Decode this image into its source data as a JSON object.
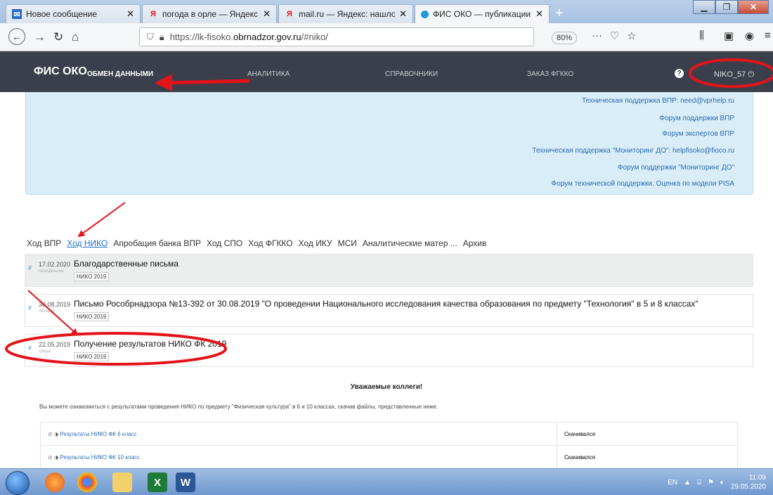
{
  "browser": {
    "tabs": [
      {
        "title": "Новое сообщение",
        "close": "✕"
      },
      {
        "title": "погода в орле — Яндекс: наш",
        "close": "✕"
      },
      {
        "title": "mail.ru — Яндекс: нашлось 12",
        "close": "✕"
      },
      {
        "title": "ФИС ОКО — публикации",
        "close": "✕"
      }
    ],
    "new_tab": "+",
    "url_prefix": "https://lk-fisoko.",
    "url_domain": "obrnadzor.gov.ru",
    "url_suffix": "/#niko/",
    "zoom": "80%",
    "more": "···"
  },
  "site": {
    "logo": "ФИС ОКО",
    "nav": [
      "ОБМЕН ДАННЫМИ",
      "АНАЛИТИКА",
      "СПРАВОЧНИКИ",
      "ЗАКАЗ ФГККО"
    ],
    "help": "?",
    "user": "NIKO_57"
  },
  "info_links": [
    "Техническая поддержка ВПР: need@vprhelp.ru",
    "Форум поддержки ВПР",
    "Форум экспертов ВПР",
    "Техническая поддержка \"Мониторинг ДО\": helpfisoko@fioco.ru",
    "Форум поддержки \"Мониторинг ДО\"",
    "Форум технической поддержки. Оценка по модели PISA"
  ],
  "pub_tabs": [
    "Ход ВПР",
    "Ход НИКО",
    "Апробация банка ВПР",
    "Ход СПО",
    "Ход ФГККО",
    "Ход ИКУ",
    "МСИ",
    "Аналитические матер ...",
    "Архив"
  ],
  "publications": [
    {
      "hash": "#",
      "date": "17.02.2020",
      "day": "понедельник",
      "title": "Благодарственные письма",
      "tag": "НИКО 2019"
    },
    {
      "hash": "#",
      "date": "30.08.2019",
      "day": "пятница",
      "title": "Письмо Рособрнадзора №13-392 от 30.08.2019 \"О проведении Национального исследования качества образования по предмету \"Технология\" в 5 и 8 классах\"",
      "tag": "НИКО 2019"
    },
    {
      "hash": "#",
      "date": "22.05.2019",
      "day": "среда",
      "title": "Получение результатов НИКО ФК 2019",
      "tag": "НИКО 2019"
    }
  ],
  "details": {
    "heading": "Уважаемые коллеги!",
    "text": "Вы можете ознакомиться с результатами проведения НИКО по предмету \"Физическая культура\" в 6 и 10 классах, скачав файлы, представленные ниже.",
    "files": [
      {
        "name": "Результаты НИКО ФК 6 класс",
        "status": "Скачивался"
      },
      {
        "name": "Результаты НИКО ФК 10 класс",
        "status": "Скачивался"
      }
    ]
  },
  "taskbar": {
    "lang": "EN",
    "time": "11:09",
    "date": "29.05.2020"
  },
  "colors": {
    "header": "#3a3f4b",
    "link": "#2c6bb3",
    "info_bg": "#d8edf7",
    "annotation": "#e3131a"
  }
}
